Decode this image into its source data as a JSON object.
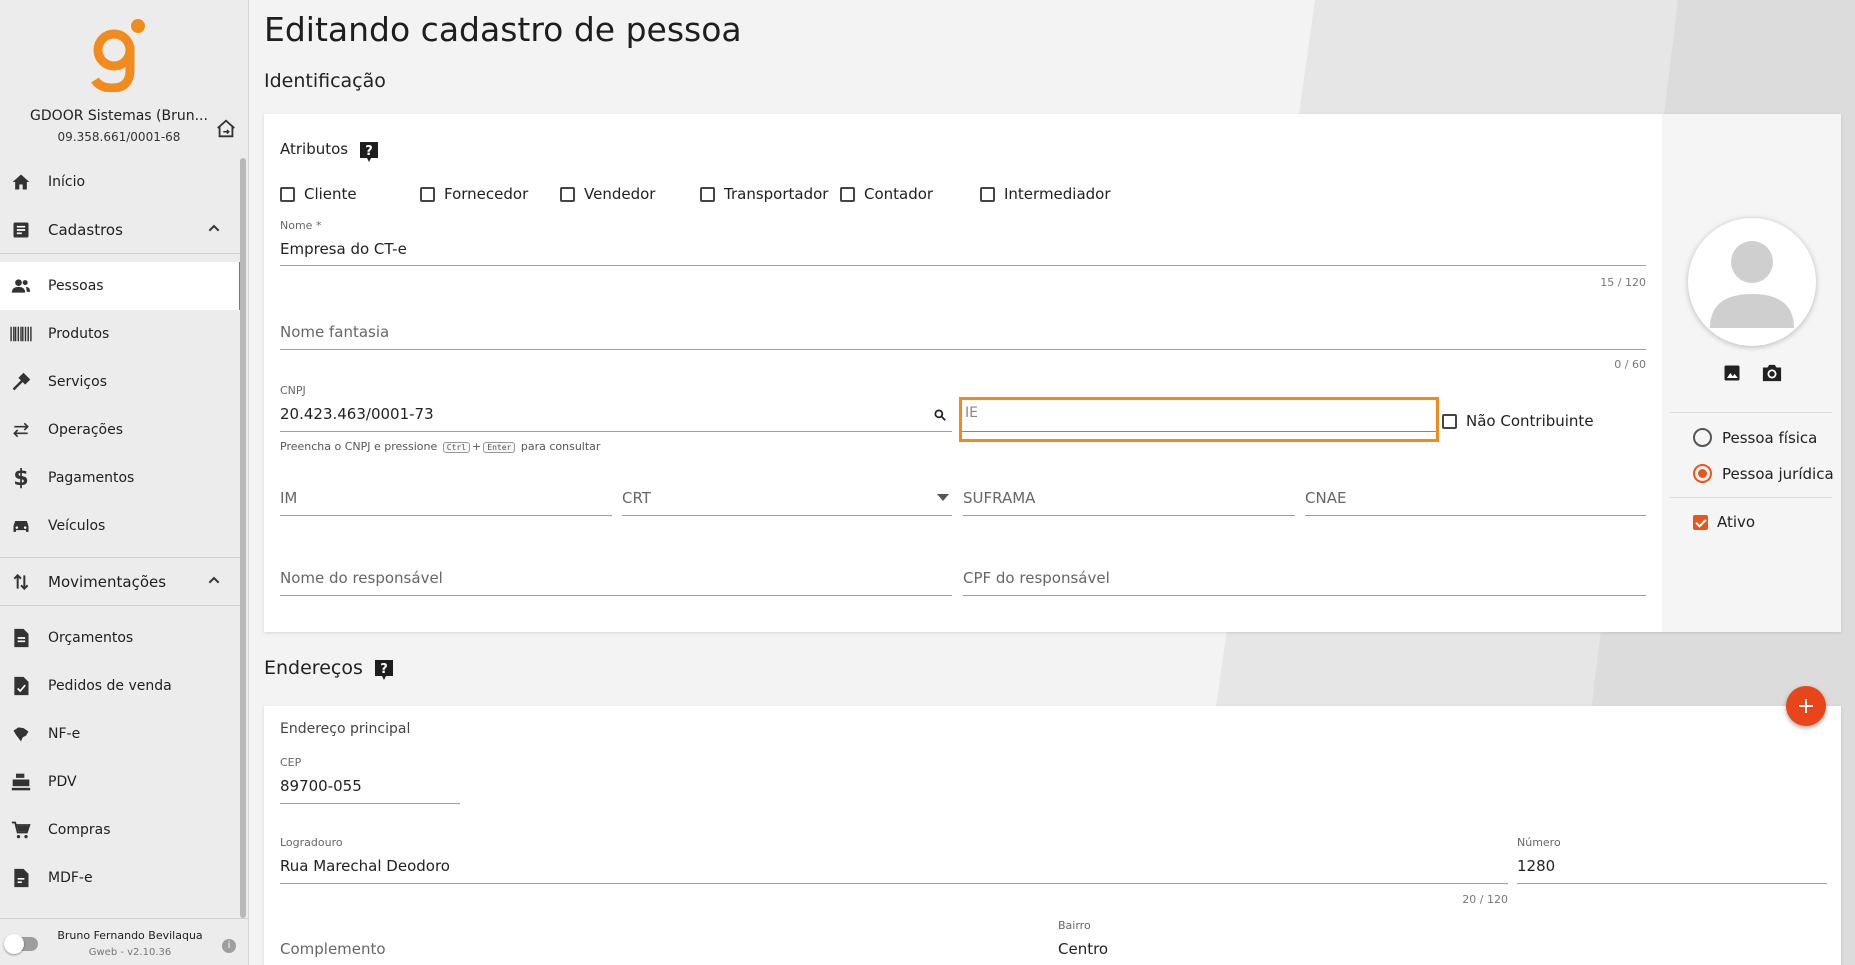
{
  "sidebar": {
    "company_name": "GDOOR Sistemas (Brun...",
    "company_cnpj": "09.358.661/0001-68",
    "nav": [
      {
        "label": "Início",
        "icon": "home-icon"
      },
      {
        "label": "Cadastros",
        "icon": "cadastros-icon"
      },
      {
        "label": "Pessoas",
        "icon": "people-icon"
      },
      {
        "label": "Produtos",
        "icon": "barcode-icon"
      },
      {
        "label": "Serviços",
        "icon": "tools-icon"
      },
      {
        "label": "Operações",
        "icon": "swap-icon"
      },
      {
        "label": "Pagamentos",
        "icon": "dollar-icon"
      },
      {
        "label": "Veículos",
        "icon": "car-icon"
      },
      {
        "label": "Movimentações",
        "icon": "swap-vertical-icon"
      },
      {
        "label": "Orçamentos",
        "icon": "document-icon"
      },
      {
        "label": "Pedidos de venda",
        "icon": "document-check-icon"
      },
      {
        "label": "NF-e",
        "icon": "brazil-map-icon"
      },
      {
        "label": "PDV",
        "icon": "cash-register-icon"
      },
      {
        "label": "Compras",
        "icon": "cart-icon"
      },
      {
        "label": "MDF-e",
        "icon": "mdfe-document-icon"
      }
    ],
    "user_name": "Bruno Fernando Bevilaqua",
    "version": "Gweb - v2.10.36",
    "accent": "#e8561a"
  },
  "page": {
    "title": "Editando cadastro de pessoa",
    "section_identificacao": "Identificação",
    "section_enderecos": "Endereços"
  },
  "identificacao": {
    "atributos_label": "Atributos",
    "atributos": [
      {
        "label": "Cliente",
        "checked": false
      },
      {
        "label": "Fornecedor",
        "checked": false
      },
      {
        "label": "Vendedor",
        "checked": false
      },
      {
        "label": "Transportador",
        "checked": false
      },
      {
        "label": "Contador",
        "checked": false
      },
      {
        "label": "Intermediador",
        "checked": false
      }
    ],
    "nome_label": "Nome *",
    "nome_value": "Empresa do CT-e",
    "nome_counter": "15 / 120",
    "nome_fantasia_placeholder": "Nome fantasia",
    "nome_fantasia_counter": "0 / 60",
    "cnpj_label": "CNPJ",
    "cnpj_value": "20.423.463/0001-73",
    "cnpj_hint_pre": "Preencha o CNPJ e pressione",
    "cnpj_hint_key1": "Ctrl",
    "cnpj_hint_plus": "+",
    "cnpj_hint_key2": "Enter",
    "cnpj_hint_post": "para consultar",
    "ie_placeholder": "IE",
    "nao_contribuinte_label": "Não Contribuinte",
    "im_placeholder": "IM",
    "crt_placeholder": "CRT",
    "suframa_placeholder": "SUFRAMA",
    "cnae_placeholder": "CNAE",
    "nome_responsavel_placeholder": "Nome do responsável",
    "cpf_responsavel_placeholder": "CPF do responsável",
    "pessoa_fisica_label": "Pessoa física",
    "pessoa_juridica_label": "Pessoa jurídica",
    "pessoa_tipo_selected": "Pessoa jurídica",
    "ativo_label": "Ativo",
    "ativo_checked": true
  },
  "enderecos": {
    "endereco_principal_label": "Endereço principal",
    "cep_label": "CEP",
    "cep_value": "89700-055",
    "logradouro_label": "Logradouro",
    "logradouro_value": "Rua Marechal Deodoro",
    "logradouro_counter": "20 / 120",
    "numero_label": "Número",
    "numero_value": "1280",
    "complemento_placeholder": "Complemento",
    "bairro_label": "Bairro",
    "bairro_value": "Centro"
  }
}
